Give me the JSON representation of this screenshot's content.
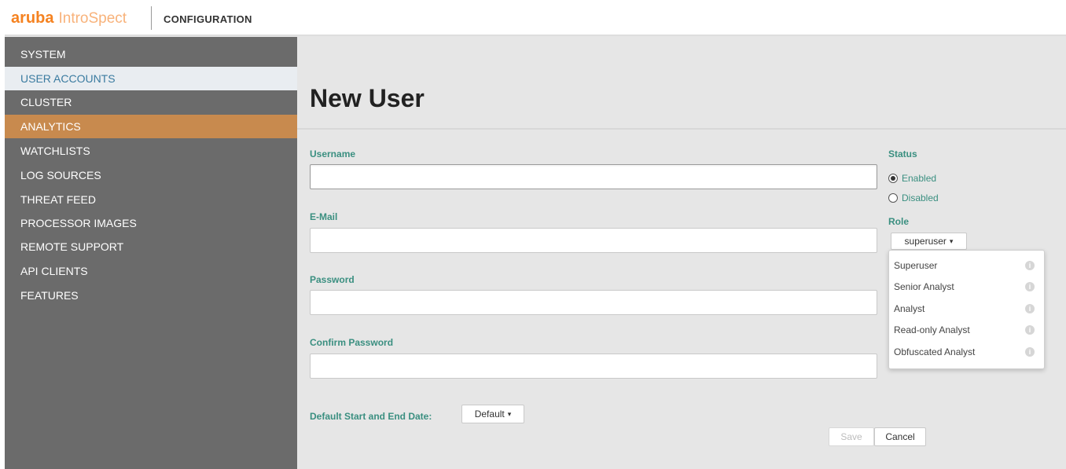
{
  "header": {
    "brand": "aruba",
    "product": "IntroSpect",
    "section_title": "CONFIGURATION"
  },
  "sidebar": {
    "items": [
      {
        "label": "SYSTEM"
      },
      {
        "label": "USER ACCOUNTS"
      },
      {
        "label": "CLUSTER"
      },
      {
        "label": "ANALYTICS"
      },
      {
        "label": "WATCHLISTS"
      },
      {
        "label": "LOG SOURCES"
      },
      {
        "label": "THREAT FEED"
      },
      {
        "label": "PROCESSOR IMAGES"
      },
      {
        "label": "REMOTE SUPPORT"
      },
      {
        "label": "API CLIENTS"
      },
      {
        "label": "FEATURES"
      }
    ]
  },
  "main": {
    "title": "New User",
    "fields": {
      "username": {
        "label": "Username",
        "value": ""
      },
      "email": {
        "label": "E-Mail",
        "value": ""
      },
      "password": {
        "label": "Password",
        "value": ""
      },
      "confirm_password": {
        "label": "Confirm Password",
        "value": ""
      }
    },
    "status": {
      "label": "Status",
      "options": [
        {
          "label": "Enabled",
          "checked": true
        },
        {
          "label": "Disabled",
          "checked": false
        }
      ]
    },
    "role": {
      "label": "Role",
      "selected": "superuser",
      "options": [
        {
          "label": "Superuser"
        },
        {
          "label": "Senior Analyst"
        },
        {
          "label": "Analyst"
        },
        {
          "label": "Read-only Analyst"
        },
        {
          "label": "Obfuscated Analyst"
        }
      ]
    },
    "date": {
      "label": "Default Start and End Date:",
      "selected": "Default"
    },
    "buttons": {
      "save": "Save",
      "cancel": "Cancel"
    }
  },
  "colors": {
    "brand_orange": "#f58220",
    "sidebar_bg": "#6b6b6b",
    "sidebar_highlight": "#c88a4e",
    "label_teal": "#3a8f80",
    "main_bg": "#e6e6e6"
  }
}
